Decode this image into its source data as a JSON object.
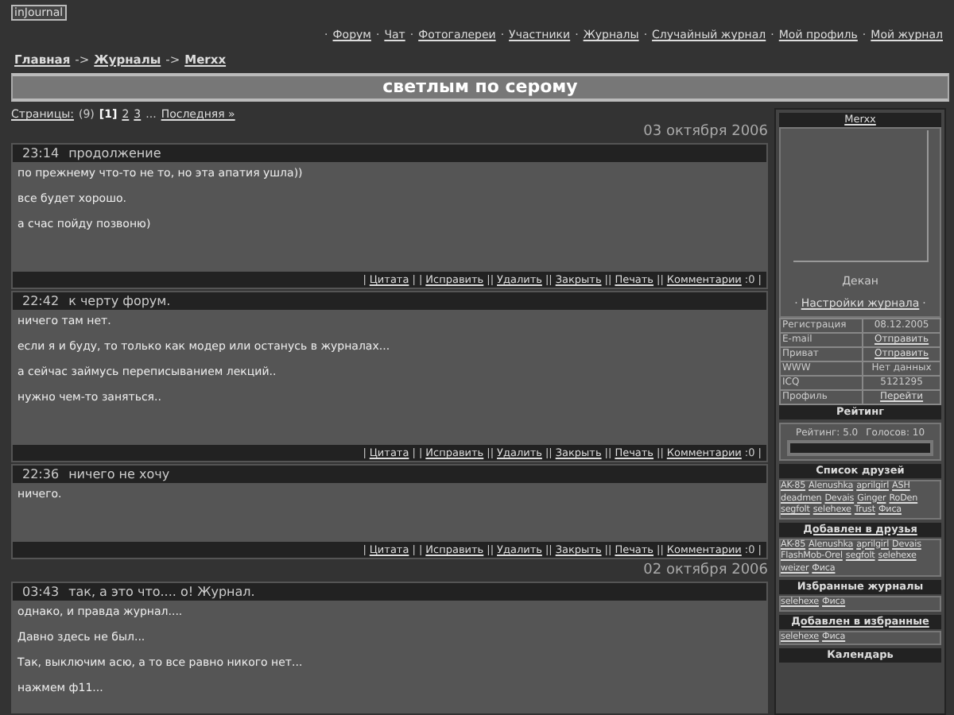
{
  "logo": "inJournal",
  "nav": [
    {
      "kind": "text",
      "text": "·"
    },
    {
      "kind": "link",
      "text": "Форум"
    },
    {
      "kind": "text",
      "text": "·"
    },
    {
      "kind": "link",
      "text": "Чат"
    },
    {
      "kind": "text",
      "text": "·"
    },
    {
      "kind": "link",
      "text": "Фотогалереи"
    },
    {
      "kind": "text",
      "text": "·"
    },
    {
      "kind": "link",
      "text": "Участники"
    },
    {
      "kind": "text",
      "text": "·"
    },
    {
      "kind": "link",
      "text": "Журналы"
    },
    {
      "kind": "text",
      "text": "·"
    },
    {
      "kind": "link",
      "text": "Случайный журнал"
    },
    {
      "kind": "text",
      "text": "·"
    },
    {
      "kind": "link",
      "text": "Мой профиль"
    },
    {
      "kind": "text",
      "text": "·"
    },
    {
      "kind": "link",
      "text": "Мой журнал"
    }
  ],
  "breadcrumb": [
    {
      "kind": "link",
      "text": "Главная"
    },
    {
      "kind": "text",
      "text": "->"
    },
    {
      "kind": "link",
      "text": "Журналы"
    },
    {
      "kind": "text",
      "text": "->"
    },
    {
      "kind": "link",
      "text": "Merxx"
    }
  ],
  "title": "светлым по серому",
  "pager": [
    {
      "kind": "link",
      "text": "Страницы:"
    },
    {
      "kind": "text",
      "text": "(9)"
    },
    {
      "kind": "current",
      "text": "[1]"
    },
    {
      "kind": "link",
      "text": "2"
    },
    {
      "kind": "link",
      "text": "3"
    },
    {
      "kind": "text",
      "text": "..."
    },
    {
      "kind": "link",
      "text": "Последняя »"
    }
  ],
  "days": [
    {
      "date": "03 октября 2006",
      "entries": [
        {
          "time": "23:14",
          "subject": "продолжение",
          "paragraphs": [
            "по прежнему что-то не то, но эта апатия ушла))",
            "все будет хорошо.",
            "а счас пойду позвоню)"
          ],
          "footer": [
            {
              "kind": "text",
              "text": "|"
            },
            {
              "kind": "link",
              "text": "Цитата"
            },
            {
              "kind": "text",
              "text": "| |"
            },
            {
              "kind": "link",
              "text": "Исправить"
            },
            {
              "kind": "text",
              "text": "||"
            },
            {
              "kind": "link",
              "text": "Удалить"
            },
            {
              "kind": "text",
              "text": "||"
            },
            {
              "kind": "link",
              "text": "Закрыть"
            },
            {
              "kind": "text",
              "text": "||"
            },
            {
              "kind": "link",
              "text": "Печать"
            },
            {
              "kind": "text",
              "text": "||"
            },
            {
              "kind": "link",
              "text": "Комментарии"
            },
            {
              "kind": "text",
              "text": ":0 |"
            }
          ]
        },
        {
          "time": "22:42",
          "subject": "к черту форум.",
          "paragraphs": [
            "ничего там нет.",
            "если я и буду, то только как модер или останусь в журналах...",
            "а сейчас займусь переписыванием лекций..",
            "нужно чем-то заняться.."
          ],
          "footer": [
            {
              "kind": "text",
              "text": "|"
            },
            {
              "kind": "link",
              "text": "Цитата"
            },
            {
              "kind": "text",
              "text": "| |"
            },
            {
              "kind": "link",
              "text": "Исправить"
            },
            {
              "kind": "text",
              "text": "||"
            },
            {
              "kind": "link",
              "text": "Удалить"
            },
            {
              "kind": "text",
              "text": "||"
            },
            {
              "kind": "link",
              "text": "Закрыть"
            },
            {
              "kind": "text",
              "text": "||"
            },
            {
              "kind": "link",
              "text": "Печать"
            },
            {
              "kind": "text",
              "text": "||"
            },
            {
              "kind": "link",
              "text": "Комментарии"
            },
            {
              "kind": "text",
              "text": ":0 |"
            }
          ]
        },
        {
          "time": "22:36",
          "subject": "ничего не хочу",
          "paragraphs": [
            "ничего."
          ],
          "footer": [
            {
              "kind": "text",
              "text": "|"
            },
            {
              "kind": "link",
              "text": "Цитата"
            },
            {
              "kind": "text",
              "text": "| |"
            },
            {
              "kind": "link",
              "text": "Исправить"
            },
            {
              "kind": "text",
              "text": "||"
            },
            {
              "kind": "link",
              "text": "Удалить"
            },
            {
              "kind": "text",
              "text": "||"
            },
            {
              "kind": "link",
              "text": "Закрыть"
            },
            {
              "kind": "text",
              "text": "||"
            },
            {
              "kind": "link",
              "text": "Печать"
            },
            {
              "kind": "text",
              "text": "||"
            },
            {
              "kind": "link",
              "text": "Комментарии"
            },
            {
              "kind": "text",
              "text": ":0 |"
            }
          ]
        }
      ]
    },
    {
      "date": "02 октября 2006",
      "entries": [
        {
          "time": "03:43",
          "subject": "так, а это что.... о! Журнал.",
          "paragraphs": [
            "однако, и правда журнал....",
            "Давно здесь не был...",
            "Так, выключим асю, а то все равно никого нет...",
            "нажмем ф11..."
          ]
        }
      ]
    }
  ],
  "sidebar": {
    "user": "Merxx",
    "rank": "Декан",
    "settings": [
      {
        "kind": "text",
        "text": "·"
      },
      {
        "kind": "link",
        "text": "Настройки журнала"
      },
      {
        "kind": "text",
        "text": "·"
      }
    ],
    "info": [
      {
        "label": "Регистрация",
        "value": "08.12.2005",
        "kind": "text"
      },
      {
        "label": "E-mail",
        "value": "Отправить",
        "kind": "link"
      },
      {
        "label": "Приват",
        "value": "Отправить",
        "kind": "link"
      },
      {
        "label": "WWW",
        "value": "Нет данных",
        "kind": "text"
      },
      {
        "label": "ICQ",
        "value": "5121295",
        "kind": "text"
      },
      {
        "label": "Профиль",
        "value": "Перейти",
        "kind": "link"
      }
    ],
    "rating_title": "Рейтинг",
    "rating": "Рейтинг: 5.0",
    "votes": "Голосов: 10",
    "lists": [
      {
        "title": "Список друзей",
        "title_link": false,
        "items": [
          "AK-85",
          "Alenushka",
          "aprilgirl",
          "ASH",
          "deadmen",
          "Devais",
          "Ginger",
          "RoDen",
          "segfolt",
          "selehexe",
          "Trust",
          "Фиса"
        ]
      },
      {
        "title": "Добавлен в друзья",
        "title_link": true,
        "items": [
          "AK-85",
          "Alenushka",
          "aprilgirl",
          "Devais",
          "FlashMob-Orel",
          "segfolt",
          "selehexe",
          "weizer",
          "Фиса"
        ]
      },
      {
        "title": "Избранные журналы",
        "title_link": false,
        "items": [
          "selehexe",
          "Фиса"
        ]
      },
      {
        "title": "Добавлен в избранные",
        "title_link": true,
        "items": [
          "selehexe",
          "Фиса"
        ]
      }
    ],
    "calendar_title": "Календарь"
  }
}
